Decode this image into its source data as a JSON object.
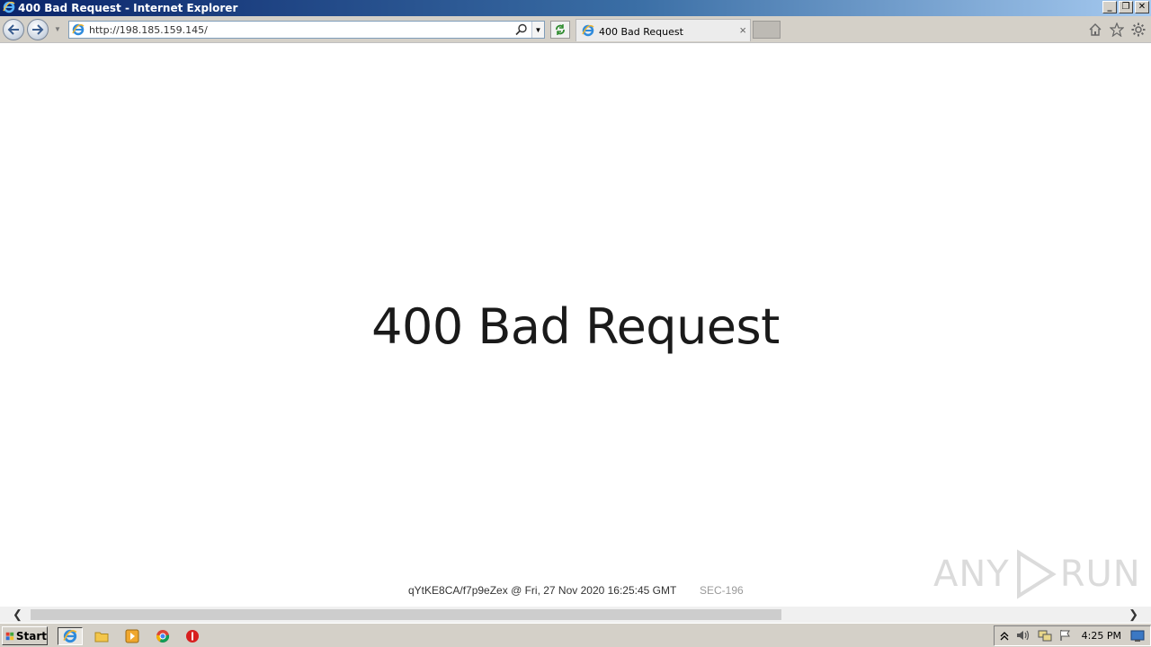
{
  "window": {
    "title": "400 Bad Request - Internet Explorer",
    "controls": {
      "minimize": "_",
      "restore": "❐",
      "close": "✕"
    }
  },
  "navbar": {
    "address_url": "http://198.185.159.145/",
    "tab_label": "400 Bad Request",
    "tab_close": "×"
  },
  "page": {
    "heading": "400 Bad Request",
    "footer_id": "qYtKE8CA/f7p9eZex @ Fri, 27 Nov 2020 16:25:45 GMT",
    "sec_code": "SEC-196"
  },
  "watermark": {
    "left": "ANY",
    "right": "RUN"
  },
  "scrollbar": {
    "left_arrow": "❮",
    "right_arrow": "❯"
  },
  "taskbar": {
    "start_label": "Start",
    "clock": "4:25 PM"
  },
  "colors": {
    "titlebar_start": "#0a246a",
    "titlebar_end": "#a6caf0",
    "chrome": "#d4d0c8",
    "heading_text": "#1a1a1a"
  }
}
